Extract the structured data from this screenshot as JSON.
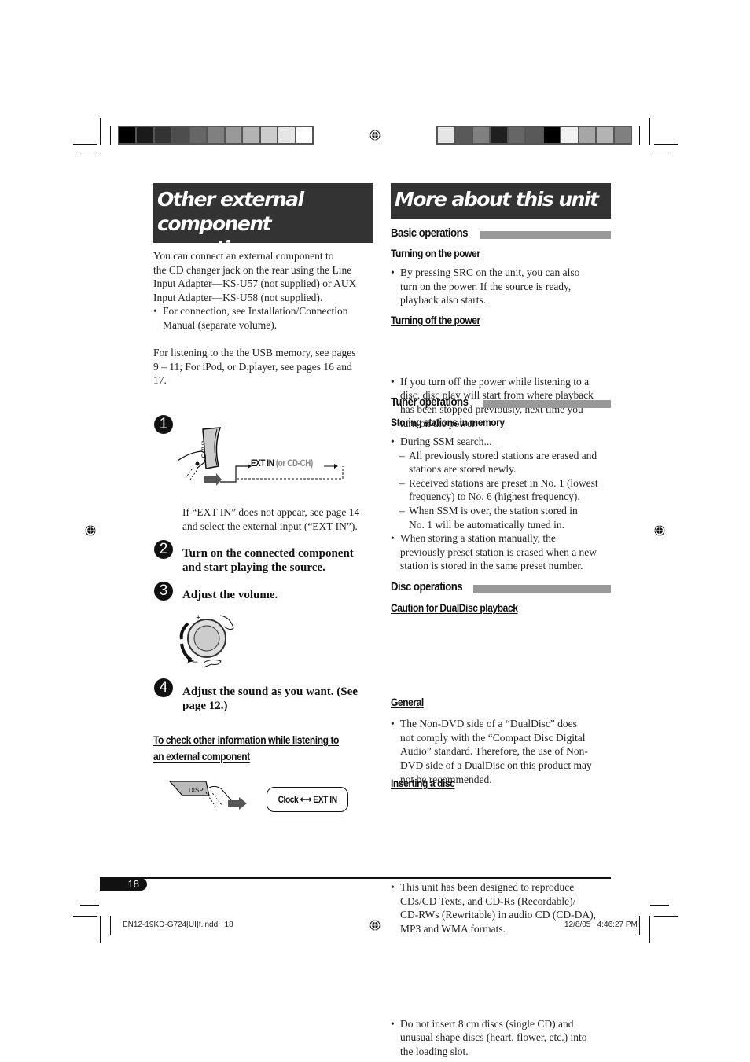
{
  "color_bars": {
    "left": [
      "#000000",
      "#1a1a1a",
      "#333333",
      "#4d4d4d",
      "#666666",
      "#808080",
      "#999999",
      "#b3b3b3",
      "#cccccc",
      "#e6e6e6",
      "#ffffff"
    ],
    "right": [
      "#e6e6e6",
      "#595959",
      "#808080",
      "#1f1f1f",
      "#666666",
      "#595959",
      "#000000",
      "#f2f2f2",
      "#a6a6a6",
      "#b3b3b3",
      "#808080"
    ]
  },
  "left_column": {
    "title_line1": "Other external component",
    "title_line2": "operations",
    "intro_lines": [
      "You can connect an external component to",
      "the CD changer jack on the rear using the Line",
      "Input Adapter—KS-U57 (not supplied) or AUX",
      "Input Adapter—KS-U58 (not supplied)."
    ],
    "intro_bullet_lines": [
      "For connection, see Installation/Connection",
      "Manual (separate volume)."
    ],
    "usb_note_lines": [
      "For listening to the the USB memory, see pages",
      "9 – 11; For iPod, or D.player, see pages 16 and",
      "17."
    ],
    "steps": [
      {
        "number": "1",
        "text": ""
      },
      {
        "number": "2",
        "text_lines": [
          "Turn on the connected component",
          "and start playing the source."
        ]
      },
      {
        "number": "3",
        "text_lines": [
          "Adjust the volume."
        ]
      },
      {
        "number": "4",
        "text_lines": [
          "Adjust the sound as you want. (See",
          "page 12.)"
        ]
      }
    ],
    "step1_diagram": {
      "button_label": "SRC",
      "ext_in": "EXT IN",
      "or_cdch": "(or CD-CH)"
    },
    "step1_note_lines": [
      "If “EXT IN” does not appear, see page 14",
      "and select the external input (“EXT IN”)."
    ],
    "volume_diagram": {
      "plus": "+",
      "minus": "–"
    },
    "check_heading_lines": [
      "To check other information while listening to",
      "an external component"
    ],
    "disp_diagram": {
      "button_label": "DISP",
      "clock": "Clock",
      "ext_in": "EXT IN"
    }
  },
  "right_column": {
    "title": "More about this unit",
    "sections": [
      {
        "heading": "Basic operations",
        "subsections": [
          {
            "title": "Turning on the power",
            "bullets": [
              [
                "By pressing SRC on the unit, you can also",
                "turn on the power. If the source is ready,",
                "playback also starts."
              ]
            ]
          },
          {
            "title": "Turning off the power",
            "bullets": [
              [
                "If you turn off the power while listening to a",
                "disc, disc play will start from where playback",
                "has been stopped previously, next time you",
                "turn on the power."
              ]
            ]
          }
        ]
      },
      {
        "heading": "Tuner operations",
        "subsections": [
          {
            "title": "Storing stations in memory",
            "bullet1": "During SSM search...",
            "dashes": [
              [
                "All previously stored stations are erased and",
                "stations are stored newly."
              ],
              [
                "Received stations are preset in No. 1 (lowest",
                "frequency) to No. 6 (highest frequency)."
              ],
              [
                "When SSM is over, the station stored in",
                "No. 1 will be automatically tuned in."
              ]
            ],
            "bullet2": [
              "When storing a station manually, the",
              "previously preset station is erased when a new",
              "station is stored in the same preset number."
            ]
          }
        ]
      },
      {
        "heading": "Disc operations",
        "subsections": [
          {
            "title": "Caution for DualDisc playback",
            "bullets": [
              [
                "The Non-DVD side of a “DualDisc” does",
                "not comply with the “Compact Disc Digital",
                "Audio” standard. Therefore, the use of Non-",
                "DVD side of a DualDisc on this product may",
                "not be recommended."
              ]
            ]
          },
          {
            "title": "General",
            "bullets": [
              [
                "This unit has been designed to reproduce",
                "CDs/CD Texts, and CD-Rs (Recordable)/",
                "CD-RWs (Rewritable) in audio CD (CD-DA),",
                "MP3 and WMA formats."
              ]
            ]
          },
          {
            "title": "Inserting a disc",
            "bullets": [
              [
                "Do not insert 8 cm discs (single CD) and",
                "unusual shape discs (heart, flower, etc.) into",
                "the loading slot."
              ]
            ]
          }
        ]
      }
    ]
  },
  "page_number": "18",
  "footer": {
    "file": "EN12-19KD-G724[UI]f.indd   18",
    "timestamp": "12/8/05   4:46:27 PM"
  }
}
